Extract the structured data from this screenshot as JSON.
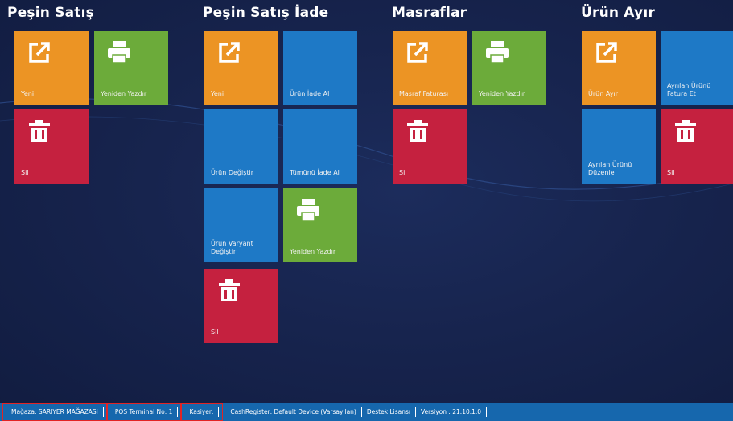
{
  "groups": [
    {
      "title": "Peşin Satış",
      "tiles": [
        {
          "label": "Yeni",
          "color": "#ec9424",
          "icon": "external-link-icon"
        },
        {
          "label": "Yeniden Yazdır",
          "color": "#6cab3a",
          "icon": "printer-icon"
        },
        {
          "label": "Sil",
          "color": "#c5213f",
          "icon": "trash-icon"
        }
      ]
    },
    {
      "title": "Peşin Satış İade",
      "tiles": [
        {
          "label": "Yeni",
          "color": "#ec9424",
          "icon": "external-link-icon"
        },
        {
          "label": "Ürün İade Al",
          "color": "#1e79c6"
        },
        {
          "label": "Ürün Değiştir",
          "color": "#1e79c6"
        },
        {
          "label": "Tümünü İade Al",
          "color": "#1e79c6"
        },
        {
          "label": "Ürün Varyant Değiştir",
          "color": "#1e79c6"
        },
        {
          "label": "Yeniden Yazdır",
          "color": "#6cab3a",
          "icon": "printer-icon"
        },
        {
          "label": "Sil",
          "color": "#c5213f",
          "icon": "trash-icon"
        }
      ]
    },
    {
      "title": "Masraflar",
      "tiles": [
        {
          "label": "Masraf Faturası",
          "color": "#ec9424",
          "icon": "external-link-icon"
        },
        {
          "label": "Yeniden Yazdır",
          "color": "#6cab3a",
          "icon": "printer-icon"
        },
        {
          "label": "Sil",
          "color": "#c5213f",
          "icon": "trash-icon"
        }
      ]
    },
    {
      "title": "Ürün Ayır",
      "tiles": [
        {
          "label": "Ürün Ayır",
          "color": "#ec9424",
          "icon": "external-link-icon"
        },
        {
          "label": "Ayrılan Ürünü Fatura Et",
          "color": "#1e79c6"
        },
        {
          "label": "Ayrılan Ürünü Düzenle",
          "color": "#1e79c6"
        },
        {
          "label": "Sil",
          "color": "#c5213f",
          "icon": "trash-icon"
        }
      ]
    }
  ],
  "statusbar": {
    "store": "Mağaza: SARIYER MAĞAZASI",
    "terminal": "POS Terminal No: 1",
    "cashier": "Kasiyer:",
    "cash_register": "CashRegister: Default Device (Varsayılan)",
    "license": "Destek Lisansı",
    "version": "Versiyon : 21.10.1.0"
  }
}
